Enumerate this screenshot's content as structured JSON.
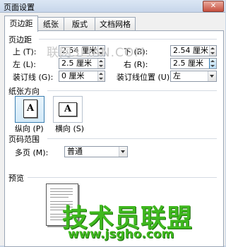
{
  "window": {
    "title": "页面设置"
  },
  "tabs": [
    {
      "label": "页边距",
      "active": true
    },
    {
      "label": "纸张",
      "active": false
    },
    {
      "label": "版式",
      "active": false
    },
    {
      "label": "文档网格",
      "active": false
    }
  ],
  "margins": {
    "section_label": "页边距",
    "top_label": "上 (T):",
    "top_value": "2.54 厘米",
    "bottom_label": "下 (B):",
    "bottom_value": "2.54 厘米",
    "left_label": "左 (L):",
    "left_value": "2.5 厘米",
    "right_label": "右 (R):",
    "right_value": "2.5 厘米",
    "gutter_label": "装订线 (G):",
    "gutter_value": "0 厘米",
    "gutter_pos_label": "装订线位置 (U):",
    "gutter_pos_value": "左"
  },
  "orientation": {
    "section_label": "纸张方向",
    "portrait_label": "纵向 (P)",
    "landscape_label": "横向 (S)",
    "icon_letter": "A",
    "selected": "portrait"
  },
  "pages": {
    "section_label": "页码范围",
    "multiple_label": "多页 (M):",
    "multiple_value": "普通"
  },
  "preview": {
    "section_label": "预览"
  },
  "watermarks": {
    "top": "3LIAN.COM",
    "top_prefix": "联网",
    "bottom_title": "技术员联盟",
    "bottom_url": "www.jsgho.com",
    "top_color": "#c8c8c8",
    "brand_color": "#3fb81f"
  },
  "colors": {
    "accent": "#3c7fb1",
    "title_bar": "#c7d6ea"
  }
}
